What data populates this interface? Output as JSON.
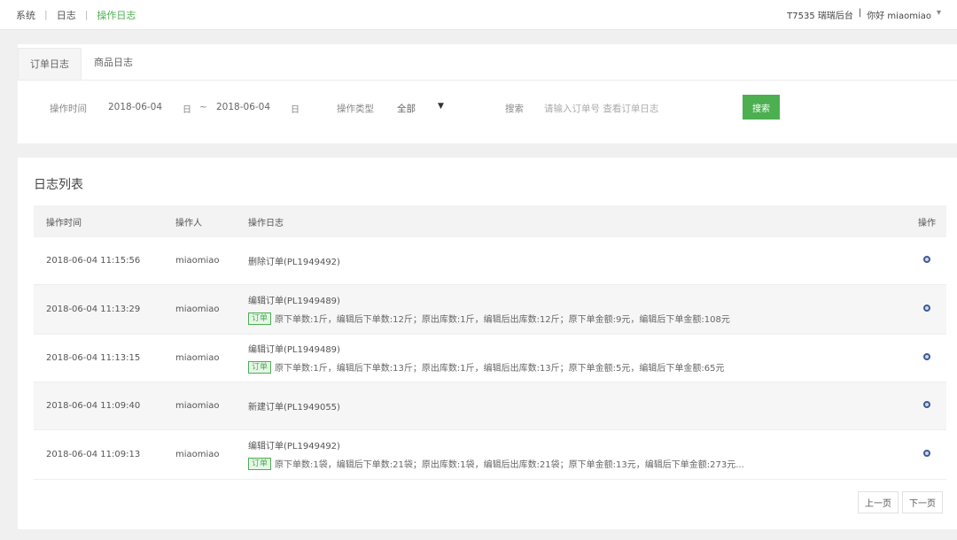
{
  "breadcrumb": {
    "items": [
      "系统",
      "日志",
      "操作日志"
    ]
  },
  "header": {
    "store": "T7535 瑞瑞后台",
    "greeting": "你好 miaomiao",
    "dropdown": "▾"
  },
  "tabs": [
    "订单日志",
    "商品日志"
  ],
  "filters": {
    "time_label": "操作时间",
    "start_date": "2018-06-04",
    "separator": "~",
    "end_date": "2018-06-04",
    "type_label": "操作类型",
    "type_value": "全部",
    "keyword_label": "搜索",
    "keyword_placeholder": "请输入订单号 查看订单日志",
    "search_button": "搜索",
    "calendar_icon": "日"
  },
  "list": {
    "title": "日志列表",
    "columns": [
      "操作时间",
      "操作人",
      "操作日志",
      "操作"
    ],
    "rows": [
      {
        "time": "2018-06-04 11:15:56",
        "operator": "miaomiao",
        "log": "删除订单(PL1949492)",
        "detail": ""
      },
      {
        "time": "2018-06-04 11:13:29",
        "operator": "miaomiao",
        "log": "编辑订单(PL1949489)",
        "tag": "订单",
        "detail": "原下单数:1斤，编辑后下单数:12斤；原出库数:1斤，编辑后出库数:12斤；原下单金额:9元，编辑后下单金额:108元"
      },
      {
        "time": "2018-06-04 11:13:15",
        "operator": "miaomiao",
        "log": "编辑订单(PL1949489)",
        "tag": "订单",
        "detail": "原下单数:1斤，编辑后下单数:13斤；原出库数:1斤，编辑后出库数:13斤；原下单金额:5元，编辑后下单金额:65元"
      },
      {
        "time": "2018-06-04 11:09:40",
        "operator": "miaomiao",
        "log": "新建订单(PL1949055)",
        "detail": ""
      },
      {
        "time": "2018-06-04 11:09:13",
        "operator": "miaomiao",
        "log": "编辑订单(PL1949492)",
        "tag": "订单",
        "detail": "原下单数:1袋，编辑后下单数:21袋；原出库数:1袋，编辑后出库数:21袋；原下单金额:13元，编辑后下单金额:273元..."
      }
    ]
  },
  "pagination": {
    "prev": "上一页",
    "next": "下一页"
  }
}
